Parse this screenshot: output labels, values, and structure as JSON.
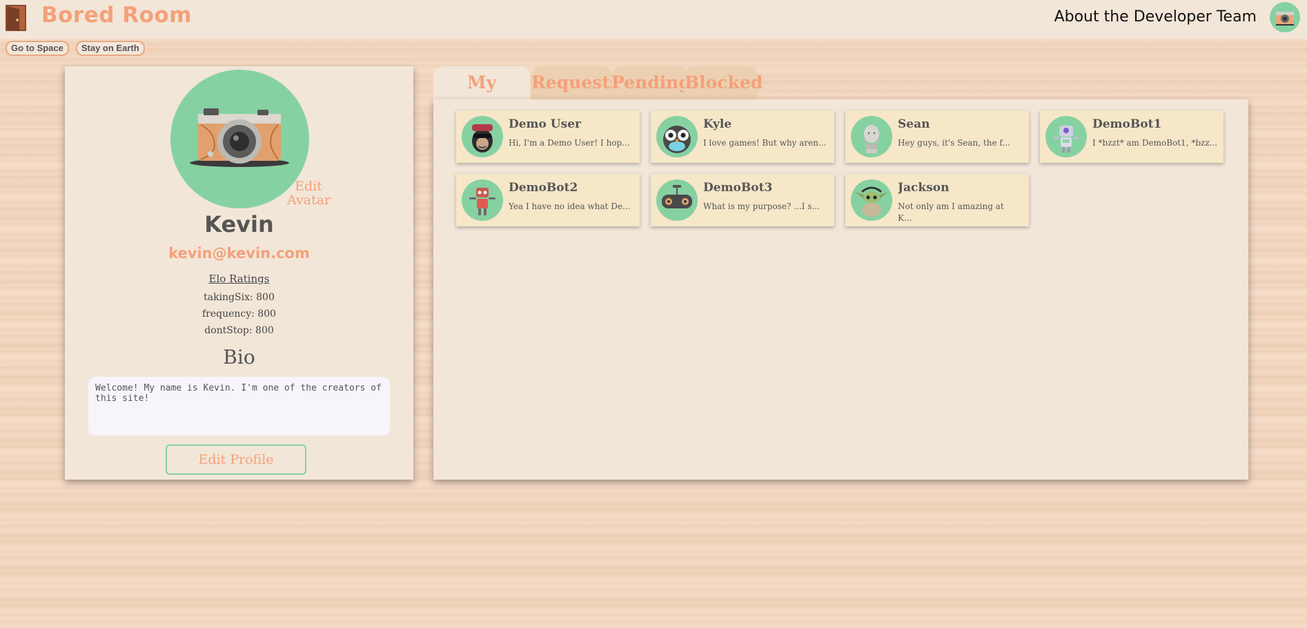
{
  "header": {
    "title": "Bored Room",
    "about": "About the Developer Team",
    "logo_icon": "door-icon",
    "avatar_icon": "camera-icon"
  },
  "space_buttons": {
    "go": "Go to Space",
    "stay": "Stay on Earth"
  },
  "profile": {
    "edit_avatar": "Edit Avatar",
    "name": "Kevin",
    "email": "kevin@kevin.com",
    "elo_title": "Elo Ratings",
    "elo": [
      {
        "label": "takingSix: 800"
      },
      {
        "label": "frequency: 800"
      },
      {
        "label": "dontStop: 800"
      }
    ],
    "bio_title": "Bio",
    "bio_text": "Welcome! My name is Kevin. I'm one of the creators of this site!",
    "edit_profile": "Edit Profile"
  },
  "tabs": [
    {
      "label": "My Friends",
      "active": true
    },
    {
      "label": "Requests",
      "active": false
    },
    {
      "label": "Pending",
      "active": false
    },
    {
      "label": "Blocked",
      "active": false
    }
  ],
  "friends": [
    {
      "name": "Demo User",
      "bio": "Hi, I'm a Demo User! I hop...",
      "icon": "monkey-icon"
    },
    {
      "name": "Kyle",
      "bio": "I love games! But why aren...",
      "icon": "owl-icon"
    },
    {
      "name": "Sean",
      "bio": "Hey guys, it's Sean, the f...",
      "icon": "bust-icon"
    },
    {
      "name": "DemoBot1",
      "bio": "I *bzzt* am DemoBot1, *bzz...",
      "icon": "robot-icon"
    },
    {
      "name": "DemoBot2",
      "bio": "Yea I have no idea what De...",
      "icon": "robot-red-icon"
    },
    {
      "name": "DemoBot3",
      "bio": "What is my purpose? ...I s...",
      "icon": "gamepad-icon"
    },
    {
      "name": "Jackson",
      "bio": "Not only am I amazing at K...",
      "icon": "baby-yoda-icon"
    }
  ],
  "colors": {
    "accent": "#f4a07a",
    "green": "#86d1a2",
    "card": "#f2e6d8",
    "friend_card": "#f6e7c9"
  }
}
